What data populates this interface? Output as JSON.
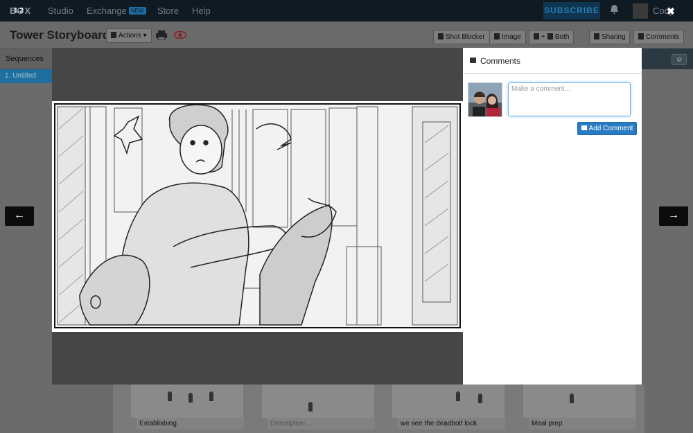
{
  "nav": {
    "logo": "BOX",
    "links": [
      "Studio",
      "Exchange",
      "Store",
      "Help"
    ],
    "new_badge": "NEW",
    "subscribe": "SUBSCRIBE",
    "username": "Cody"
  },
  "toolbar": {
    "title": "Tower Storyboard",
    "actions": "Actions",
    "shot_blocker": "Shot Blocker",
    "image": "Image",
    "both": "Both",
    "both_prefix": "+",
    "sharing": "Sharing",
    "comments": "Comments"
  },
  "sidebar": {
    "heading": "Sequences",
    "items": [
      "1. Untitled"
    ]
  },
  "viewer": {
    "frame_number": "1.2",
    "close": "✖",
    "prev": "←",
    "next": "→"
  },
  "comments": {
    "title": "Comments",
    "placeholder": "Make a comment...",
    "add_button": "Add Comment"
  },
  "storyboard_cards": [
    {
      "description": "Establishing",
      "placeholder": false
    },
    {
      "description": "Description...",
      "placeholder": true
    },
    {
      "description": "we see the deadbolt lock",
      "placeholder": false
    },
    {
      "description": "Meal prep",
      "placeholder": false
    }
  ],
  "colors": {
    "accent": "#2a7cc2",
    "nav_bg": "#101a23",
    "sidebar_active": "#1f6f9e"
  }
}
